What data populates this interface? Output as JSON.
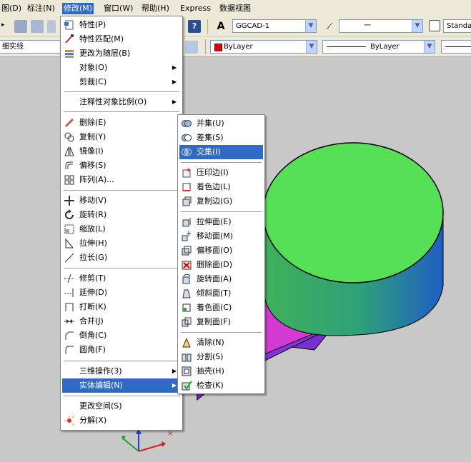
{
  "menubar": {
    "items": [
      "图(D)",
      "标注(N)",
      "修改(M)",
      "窗口(W)",
      "帮助(H)",
      "Express",
      "数据视图"
    ]
  },
  "toolbar": {
    "textstyle_value": "GGCAD-1",
    "dimstyle_value": "一",
    "tablestyle_value": "Standa",
    "linetype_partial": "细实线",
    "color_value": "ByLayer",
    "linetype_value": "ByLayer",
    "help_icon": "help-icon"
  },
  "modify_menu": {
    "items": [
      {
        "label": "特性(P)",
        "icon": "properties-icon"
      },
      {
        "label": "特性匹配(M)",
        "icon": "match-properties-icon"
      },
      {
        "label": "更改为随层(B)",
        "icon": "bylayer-icon"
      },
      {
        "label": "对象(O)",
        "submenu": true
      },
      {
        "label": "剪裁(C)",
        "submenu": true
      },
      {
        "label": "注释性对象比例(O)",
        "submenu": true
      },
      {
        "label": "删除(E)",
        "icon": "erase-icon"
      },
      {
        "label": "复制(Y)",
        "icon": "copy-icon"
      },
      {
        "label": "镜像(I)",
        "icon": "mirror-icon"
      },
      {
        "label": "偏移(S)",
        "icon": "offset-icon"
      },
      {
        "label": "阵列(A)...",
        "icon": "array-icon"
      },
      {
        "label": "移动(V)",
        "icon": "move-icon"
      },
      {
        "label": "旋转(R)",
        "icon": "rotate-icon"
      },
      {
        "label": "缩放(L)",
        "icon": "scale-icon"
      },
      {
        "label": "拉伸(H)",
        "icon": "stretch-icon"
      },
      {
        "label": "拉长(G)",
        "icon": "lengthen-icon"
      },
      {
        "label": "修剪(T)",
        "icon": "trim-icon"
      },
      {
        "label": "延伸(D)",
        "icon": "extend-icon"
      },
      {
        "label": "打断(K)",
        "icon": "break-icon"
      },
      {
        "label": "合并(J)",
        "icon": "join-icon"
      },
      {
        "label": "倒角(C)",
        "icon": "chamfer-icon"
      },
      {
        "label": "圆角(F)",
        "icon": "fillet-icon"
      },
      {
        "label": "三维操作(3)",
        "submenu": true
      },
      {
        "label": "实体编辑(N)",
        "submenu": true
      },
      {
        "label": "更改空间(S)"
      },
      {
        "label": "分解(X)",
        "icon": "explode-icon"
      }
    ]
  },
  "solid_edit_menu": {
    "items": [
      {
        "label": "并集(U)",
        "icon": "union-icon"
      },
      {
        "label": "差集(S)",
        "icon": "subtract-icon"
      },
      {
        "label": "交集(I)",
        "icon": "intersect-icon"
      },
      {
        "label": "压印边(I)",
        "icon": "imprint-edges-icon"
      },
      {
        "label": "着色边(L)",
        "icon": "color-edges-icon"
      },
      {
        "label": "复制边(G)",
        "icon": "copy-edges-icon"
      },
      {
        "label": "拉伸面(E)",
        "icon": "extrude-faces-icon"
      },
      {
        "label": "移动面(M)",
        "icon": "move-faces-icon"
      },
      {
        "label": "偏移面(O)",
        "icon": "offset-faces-icon"
      },
      {
        "label": "删除面(D)",
        "icon": "delete-faces-icon"
      },
      {
        "label": "旋转面(A)",
        "icon": "rotate-faces-icon"
      },
      {
        "label": "倾斜面(T)",
        "icon": "taper-faces-icon"
      },
      {
        "label": "着色面(C)",
        "icon": "color-faces-icon"
      },
      {
        "label": "复制面(F)",
        "icon": "copy-faces-icon"
      },
      {
        "label": "清除(N)",
        "icon": "clean-icon"
      },
      {
        "label": "分割(S)",
        "icon": "separate-icon"
      },
      {
        "label": "抽壳(H)",
        "icon": "shell-icon"
      },
      {
        "label": "检查(K)",
        "icon": "check-icon"
      }
    ]
  },
  "colors": {
    "menu_highlight": "#316ac5",
    "cylinder_top": "#55e055",
    "magenta_face": "#d23ad2",
    "purple_face": "#7a2fd0",
    "bylayer_swatch": "#e00000"
  }
}
